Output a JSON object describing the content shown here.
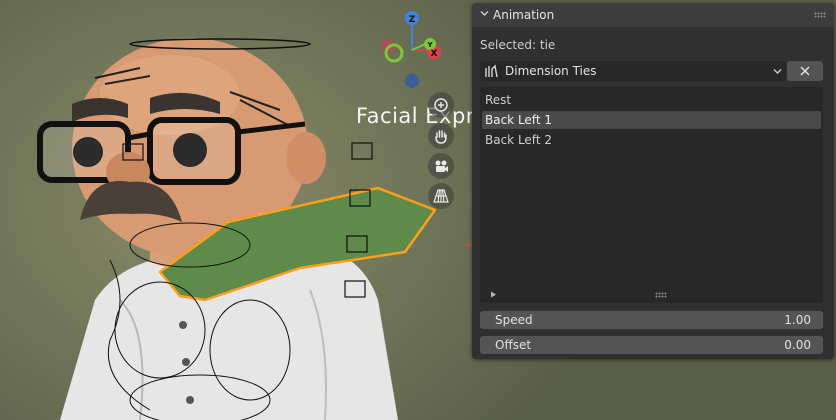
{
  "viewport": {
    "overlay_text": "Facial Expre",
    "gizmo": {
      "z_label": "Z",
      "x_label": "X",
      "y_label": "Y"
    },
    "nav_icons": [
      "zoom-icon",
      "hand-pan-icon",
      "camera-icon",
      "perspective-grid-icon"
    ]
  },
  "panel": {
    "title": "Animation",
    "selected_label": "Selected: tie",
    "dropdown": {
      "value": "Dimension Ties"
    },
    "list": {
      "items": [
        {
          "label": "Rest",
          "selected": false
        },
        {
          "label": "Back Left 1",
          "selected": true
        },
        {
          "label": "Back Left 2",
          "selected": false
        }
      ]
    },
    "fields": {
      "speed": {
        "label": "Speed",
        "value": "1.00"
      },
      "offset": {
        "label": "Offset",
        "value": "0.00"
      }
    }
  },
  "colors": {
    "panel_bg": "#303030",
    "header_bg": "#3d3d3d",
    "field_bg": "#545454",
    "list_bg": "#282828",
    "selection": "#4a4a4a",
    "tie_green": "#5e8a4a",
    "selection_outline": "#ff9e1a",
    "axis_x": "#e0404a",
    "axis_y": "#7dc63c",
    "axis_z": "#3f84e0"
  }
}
